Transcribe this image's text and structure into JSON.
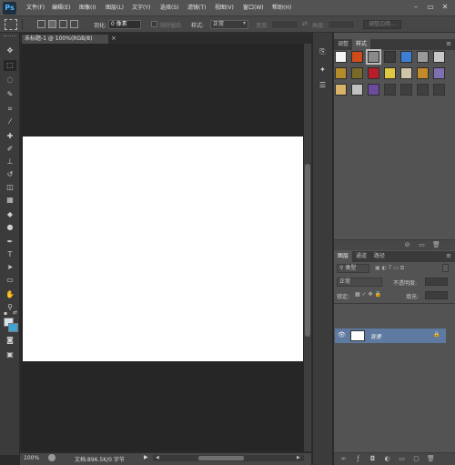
{
  "app": {
    "logo": "Ps"
  },
  "menu": [
    {
      "id": "file",
      "label": "文件(F)"
    },
    {
      "id": "edit",
      "label": "编辑(E)"
    },
    {
      "id": "image",
      "label": "图像(I)"
    },
    {
      "id": "layer",
      "label": "图层(L)"
    },
    {
      "id": "type",
      "label": "文字(Y)"
    },
    {
      "id": "select",
      "label": "选择(S)"
    },
    {
      "id": "filter",
      "label": "滤镜(T)"
    },
    {
      "id": "view",
      "label": "视图(V)"
    },
    {
      "id": "window",
      "label": "窗口(W)"
    },
    {
      "id": "help",
      "label": "帮助(H)"
    }
  ],
  "window_controls": {
    "minimize": "–",
    "restore": "▭",
    "close": "✕"
  },
  "options": {
    "feather_label": "羽化:",
    "feather_value": "0 像素",
    "antialias_label": "消除锯齿",
    "style_label": "样式:",
    "style_value": "正常",
    "width_label": "宽度:",
    "height_label": "高度:",
    "refine_edge": "调整边缘..."
  },
  "document": {
    "tab_title": "未标题-1 @ 100%(RGB/8)",
    "tab_close": "×",
    "zoom": "100%",
    "doc_info": "文档:896.5K/0 字节"
  },
  "tools": [
    {
      "name": "move-tool-icon",
      "glyph": "✥"
    },
    {
      "name": "marquee-tool-icon",
      "glyph": "⬚"
    },
    {
      "name": "lasso-tool-icon",
      "glyph": "◌"
    },
    {
      "name": "quick-select-tool-icon",
      "glyph": "✎"
    },
    {
      "name": "crop-tool-icon",
      "glyph": "⌗"
    },
    {
      "name": "eyedropper-tool-icon",
      "glyph": "⁄"
    },
    {
      "name": "healing-brush-icon",
      "glyph": "✚"
    },
    {
      "name": "brush-tool-icon",
      "glyph": "✐"
    },
    {
      "name": "clone-stamp-icon",
      "glyph": "⊥"
    },
    {
      "name": "history-brush-icon",
      "glyph": "↺"
    },
    {
      "name": "eraser-tool-icon",
      "glyph": "◫"
    },
    {
      "name": "gradient-tool-icon",
      "glyph": "▦"
    },
    {
      "name": "blur-tool-icon",
      "glyph": "◆"
    },
    {
      "name": "dodge-tool-icon",
      "glyph": "●"
    },
    {
      "name": "pen-tool-icon",
      "glyph": "✒"
    },
    {
      "name": "type-tool-icon",
      "glyph": "T"
    },
    {
      "name": "path-select-icon",
      "glyph": "➤"
    },
    {
      "name": "shape-tool-icon",
      "glyph": "▭"
    },
    {
      "name": "hand-tool-icon",
      "glyph": "✋"
    },
    {
      "name": "zoom-tool-icon",
      "glyph": "⚲"
    }
  ],
  "dock_icons": [
    {
      "name": "history-panel-icon",
      "glyph": "⎘"
    },
    {
      "name": "actions-panel-icon",
      "glyph": "✦"
    },
    {
      "name": "adjust-panel-icon",
      "glyph": "☰"
    }
  ],
  "styles_panel": {
    "tabs": [
      "调整",
      "样式"
    ],
    "active_tab": 1,
    "menu_icon": "≡",
    "swatches": [
      [
        "#f4f4f4",
        "#d14a1a",
        "#8a8a8a",
        "#3a3a3a",
        "#3d7ed6",
        "#9a9a9a",
        "#c9c9c9"
      ],
      [
        "#b58c2a",
        "#7a6a2a",
        "#b81e2a",
        "#e0c840",
        "#cfc6a8",
        "#c48a2a",
        "#7f6fb3"
      ],
      [
        "#d8b46a",
        "#c0c0c0",
        "#6b4aa0",
        "empty",
        "empty",
        "empty",
        "empty"
      ]
    ]
  },
  "layers_panel": {
    "tabs": [
      "图层",
      "通道",
      "路径"
    ],
    "active_tab": 0,
    "menu_icon": "≡",
    "kind_label": "类型",
    "blend_mode": "正常",
    "opacity_label": "不透明度:",
    "lock_label": "锁定:",
    "fill_label": "填充:",
    "layer_name": "背景"
  }
}
